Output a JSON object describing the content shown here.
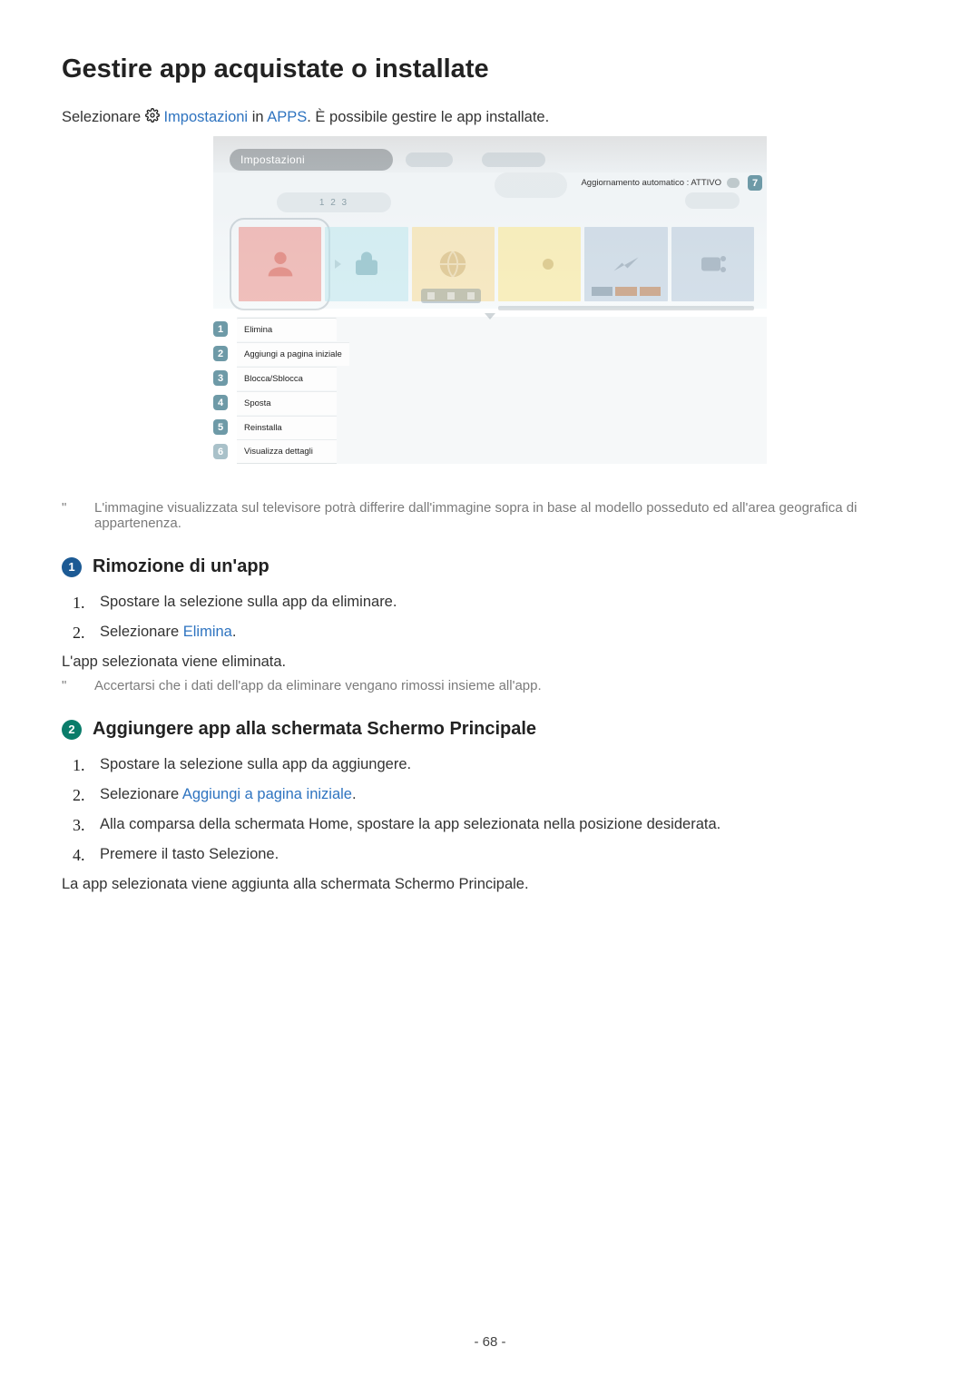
{
  "title": "Gestire app acquistate o installate",
  "intro": {
    "prefix": "Selezionare ",
    "link1": "Impostazioni",
    "mid": " in ",
    "link2": "APPS",
    "suffix": ". È possibile gestire le app installate."
  },
  "mock": {
    "header_label": "Impostazioni",
    "auto_update": "Aggiornamento automatico : ATTIVO",
    "num_pill": "1 2 3",
    "callouts": {
      "c1": "1",
      "c2": "2",
      "c3": "3",
      "c4": "4",
      "c5": "5",
      "c6": "6",
      "c7": "7"
    },
    "menu": [
      {
        "num": "1",
        "label": "Elimina"
      },
      {
        "num": "2",
        "label": "Aggiungi a pagina iniziale"
      },
      {
        "num": "3",
        "label": "Blocca/Sblocca"
      },
      {
        "num": "4",
        "label": "Sposta"
      },
      {
        "num": "5",
        "label": "Reinstalla"
      },
      {
        "num": "6",
        "label": "Visualizza dettagli"
      }
    ]
  },
  "note1": "L'immagine visualizzata sul televisore potrà differire dall'immagine sopra in base al modello posseduto ed all'area geografica di appartenenza.",
  "section1": {
    "badge": "1",
    "title": "Rimozione di un'app",
    "steps": [
      {
        "text_before": "Spostare la selezione sulla app da eliminare.",
        "link": "",
        "text_after": ""
      },
      {
        "text_before": "Selezionare ",
        "link": "Elimina",
        "text_after": "."
      }
    ],
    "result": "L'app selezionata viene eliminata.",
    "note": "Accertarsi che i dati dell'app da eliminare vengano rimossi insieme all'app."
  },
  "section2": {
    "badge": "2",
    "title": "Aggiungere app alla schermata Schermo Principale",
    "steps": [
      {
        "text_before": "Spostare la selezione sulla app da aggiungere.",
        "link": "",
        "text_after": ""
      },
      {
        "text_before": "Selezionare ",
        "link": "Aggiungi a pagina iniziale",
        "text_after": "."
      },
      {
        "text_before": "Alla comparsa della schermata Home, spostare la app selezionata nella posizione desiderata.",
        "link": "",
        "text_after": ""
      },
      {
        "text_before": "Premere il tasto Selezione.",
        "link": "",
        "text_after": ""
      }
    ],
    "result": "La app selezionata viene aggiunta alla schermata Schermo Principale."
  },
  "page_number": "- 68 -"
}
